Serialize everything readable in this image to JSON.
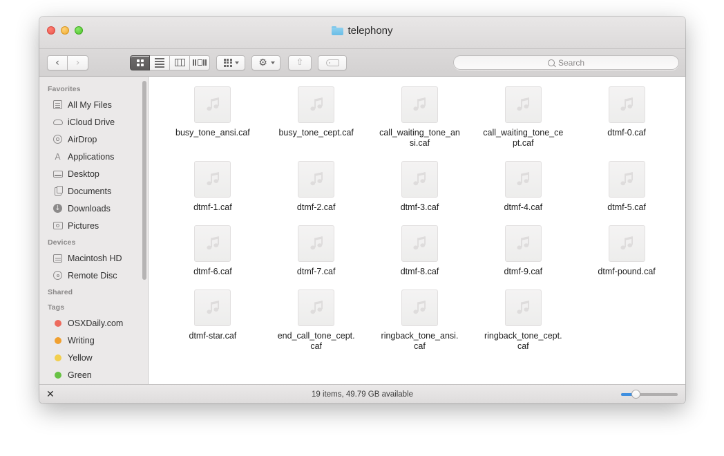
{
  "window": {
    "title": "telephony",
    "folder_icon": "folder-icon",
    "traffic_lights": [
      {
        "name": "close",
        "color": "#e9564c"
      },
      {
        "name": "minimize",
        "color": "#efac30"
      },
      {
        "name": "maximize",
        "color": "#4fc32c"
      }
    ]
  },
  "toolbar": {
    "back_label": "‹",
    "forward_label": "›",
    "view_modes": [
      {
        "name": "icon-view",
        "active": true
      },
      {
        "name": "list-view",
        "active": false
      },
      {
        "name": "column-view",
        "active": false
      },
      {
        "name": "coverflow-view",
        "active": false
      }
    ],
    "arrange_label": "arrange-icon",
    "action_label": "⚙",
    "share_label": "⇧",
    "tag_label": "tag-icon"
  },
  "search": {
    "placeholder": "Search",
    "value": ""
  },
  "sidebar": {
    "sections": [
      {
        "header": "Favorites",
        "items": [
          {
            "label": "All My Files",
            "icon": "all-my-files-icon"
          },
          {
            "label": "iCloud Drive",
            "icon": "icloud-icon"
          },
          {
            "label": "AirDrop",
            "icon": "airdrop-icon"
          },
          {
            "label": "Applications",
            "icon": "applications-icon"
          },
          {
            "label": "Desktop",
            "icon": "desktop-icon"
          },
          {
            "label": "Documents",
            "icon": "documents-icon"
          },
          {
            "label": "Downloads",
            "icon": "downloads-icon"
          },
          {
            "label": "Pictures",
            "icon": "pictures-icon"
          }
        ]
      },
      {
        "header": "Devices",
        "items": [
          {
            "label": "Macintosh HD",
            "icon": "hard-drive-icon"
          },
          {
            "label": "Remote Disc",
            "icon": "disc-icon"
          }
        ]
      },
      {
        "header": "Shared",
        "items": []
      },
      {
        "header": "Tags",
        "items": [
          {
            "label": "OSXDaily.com",
            "icon": "tag-dot-icon",
            "color": "#ed6b5e"
          },
          {
            "label": "Writing",
            "icon": "tag-dot-icon",
            "color": "#f0a030"
          },
          {
            "label": "Yellow",
            "icon": "tag-dot-icon",
            "color": "#f2cf4e"
          },
          {
            "label": "Green",
            "icon": "tag-dot-icon",
            "color": "#68c244"
          }
        ]
      }
    ]
  },
  "files": [
    {
      "name": "busy_tone_ansi.caf",
      "icon": "audio-file-icon"
    },
    {
      "name": "busy_tone_cept.caf",
      "icon": "audio-file-icon"
    },
    {
      "name": "call_waiting_tone_ansi.caf",
      "icon": "audio-file-icon"
    },
    {
      "name": "call_waiting_tone_cept.caf",
      "icon": "audio-file-icon"
    },
    {
      "name": "dtmf-0.caf",
      "icon": "audio-file-icon"
    },
    {
      "name": "dtmf-1.caf",
      "icon": "audio-file-icon"
    },
    {
      "name": "dtmf-2.caf",
      "icon": "audio-file-icon"
    },
    {
      "name": "dtmf-3.caf",
      "icon": "audio-file-icon"
    },
    {
      "name": "dtmf-4.caf",
      "icon": "audio-file-icon"
    },
    {
      "name": "dtmf-5.caf",
      "icon": "audio-file-icon"
    },
    {
      "name": "dtmf-6.caf",
      "icon": "audio-file-icon"
    },
    {
      "name": "dtmf-7.caf",
      "icon": "audio-file-icon"
    },
    {
      "name": "dtmf-8.caf",
      "icon": "audio-file-icon"
    },
    {
      "name": "dtmf-9.caf",
      "icon": "audio-file-icon"
    },
    {
      "name": "dtmf-pound.caf",
      "icon": "audio-file-icon"
    },
    {
      "name": "dtmf-star.caf",
      "icon": "audio-file-icon"
    },
    {
      "name": "end_call_tone_cept.caf",
      "icon": "audio-file-icon"
    },
    {
      "name": "ringback_tone_ansi.caf",
      "icon": "audio-file-icon"
    },
    {
      "name": "ringback_tone_cept.caf",
      "icon": "audio-file-icon"
    }
  ],
  "statusbar": {
    "close_glyph": "✕",
    "text": "19 items, 49.79 GB available",
    "zoom_value": 25
  }
}
